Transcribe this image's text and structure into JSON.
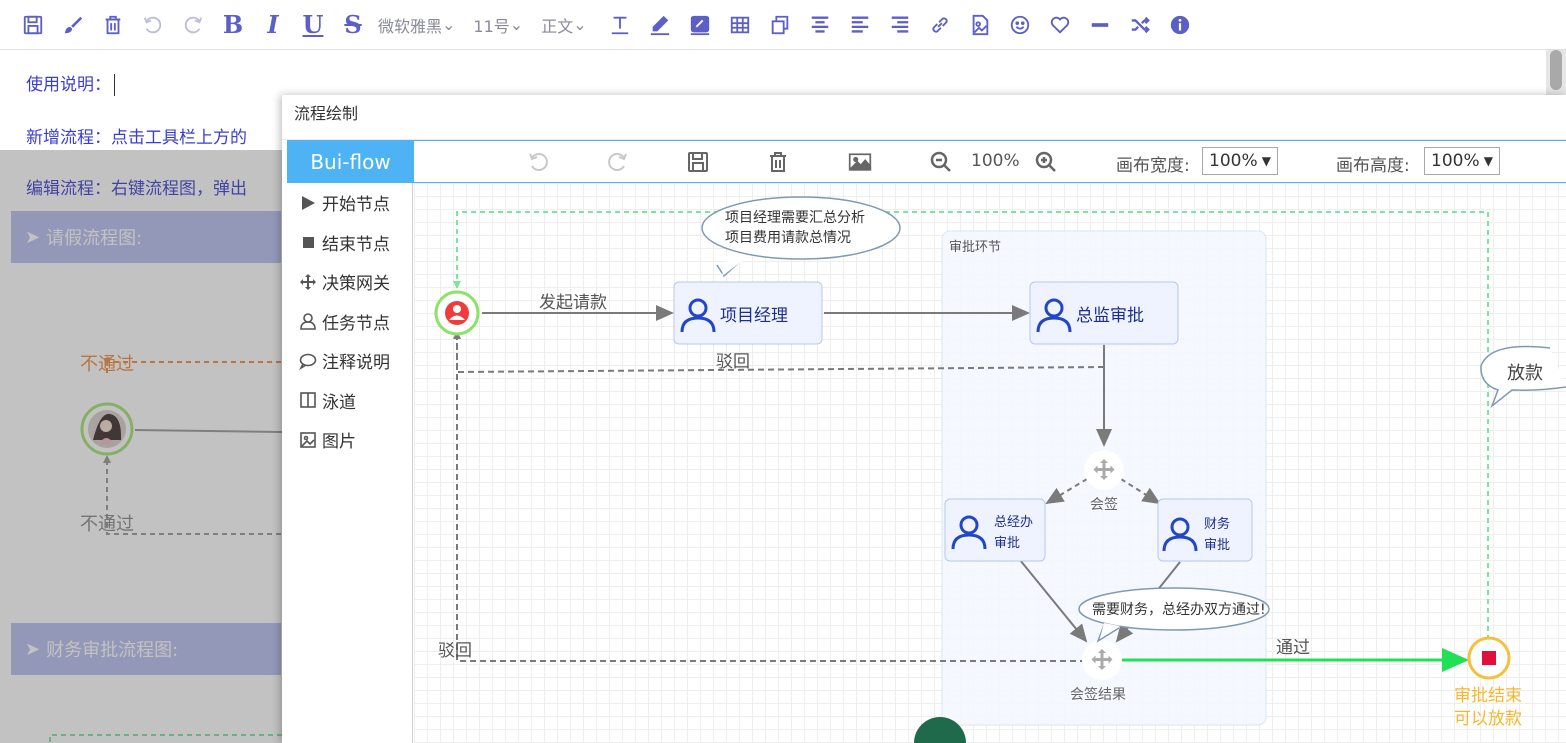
{
  "editor": {
    "toolbar": {
      "font_family": "微软雅黑",
      "font_size": "11号",
      "paragraph": "正文",
      "bold": "B",
      "italic": "I",
      "underline": "U",
      "strike": "S"
    },
    "lines": {
      "usage": "使用说明：",
      "add_flow": "新增流程：点击工具栏上方的",
      "edit_flow": "编辑流程：右键流程图，弹出"
    },
    "sections": {
      "leave": "请假流程图:",
      "finance": "财务审批流程图:"
    },
    "background_flow": {
      "reject_top": "不通过",
      "reject_bottom": "不通过"
    }
  },
  "dialog": {
    "title": "流程绘制",
    "brand": "Bui-flow",
    "toolbar": {
      "zoom": "100%",
      "canvas_width_label": "画布宽度:",
      "canvas_width_value": "100%",
      "canvas_height_label": "画布高度:",
      "canvas_height_value": "100%"
    },
    "palette": [
      {
        "icon": "play-icon",
        "label": "开始节点"
      },
      {
        "icon": "stop-square-icon",
        "label": "结束节点"
      },
      {
        "icon": "move-arrows-icon",
        "label": "决策网关"
      },
      {
        "icon": "user-icon",
        "label": "任务节点"
      },
      {
        "icon": "comment-icon",
        "label": "注释说明"
      },
      {
        "icon": "columns-icon",
        "label": "泳道"
      },
      {
        "icon": "image-icon",
        "label": "图片"
      }
    ]
  },
  "flow": {
    "swimlane": "审批环节",
    "nodes": {
      "pm": "项目经理",
      "director": "总监审批",
      "gm_line1": "总经办",
      "gm_line2": "审批",
      "fin_line1": "财务",
      "fin_line2": "审批",
      "countersign": "会签",
      "countersign_result": "会签结果",
      "end_line1": "审批结束",
      "end_line2": "可以放款"
    },
    "edges": {
      "initiate": "发起请款",
      "reject_top": "驳回",
      "reject_left": "驳回",
      "pass": "通过"
    },
    "notes": {
      "pm_note_1": "项目经理需要汇总分析",
      "pm_note_2": "项目费用请款总情况",
      "loan": "放款",
      "both_pass": "需要财务，总经办双方通过!"
    },
    "colors": {
      "user": "#2346c8",
      "node_fill": "#eef3ff",
      "node_border": "#b5c8ee",
      "edge": "#7a7a7a",
      "pass": "#22e055",
      "dash_green": "#7fe3a0",
      "end_ring": "#f5c13c",
      "end_fill": "#e0103a",
      "end_text": "#f5b82e",
      "start_ring": "#8ee26a",
      "start_fill": "#f03c3c"
    }
  }
}
